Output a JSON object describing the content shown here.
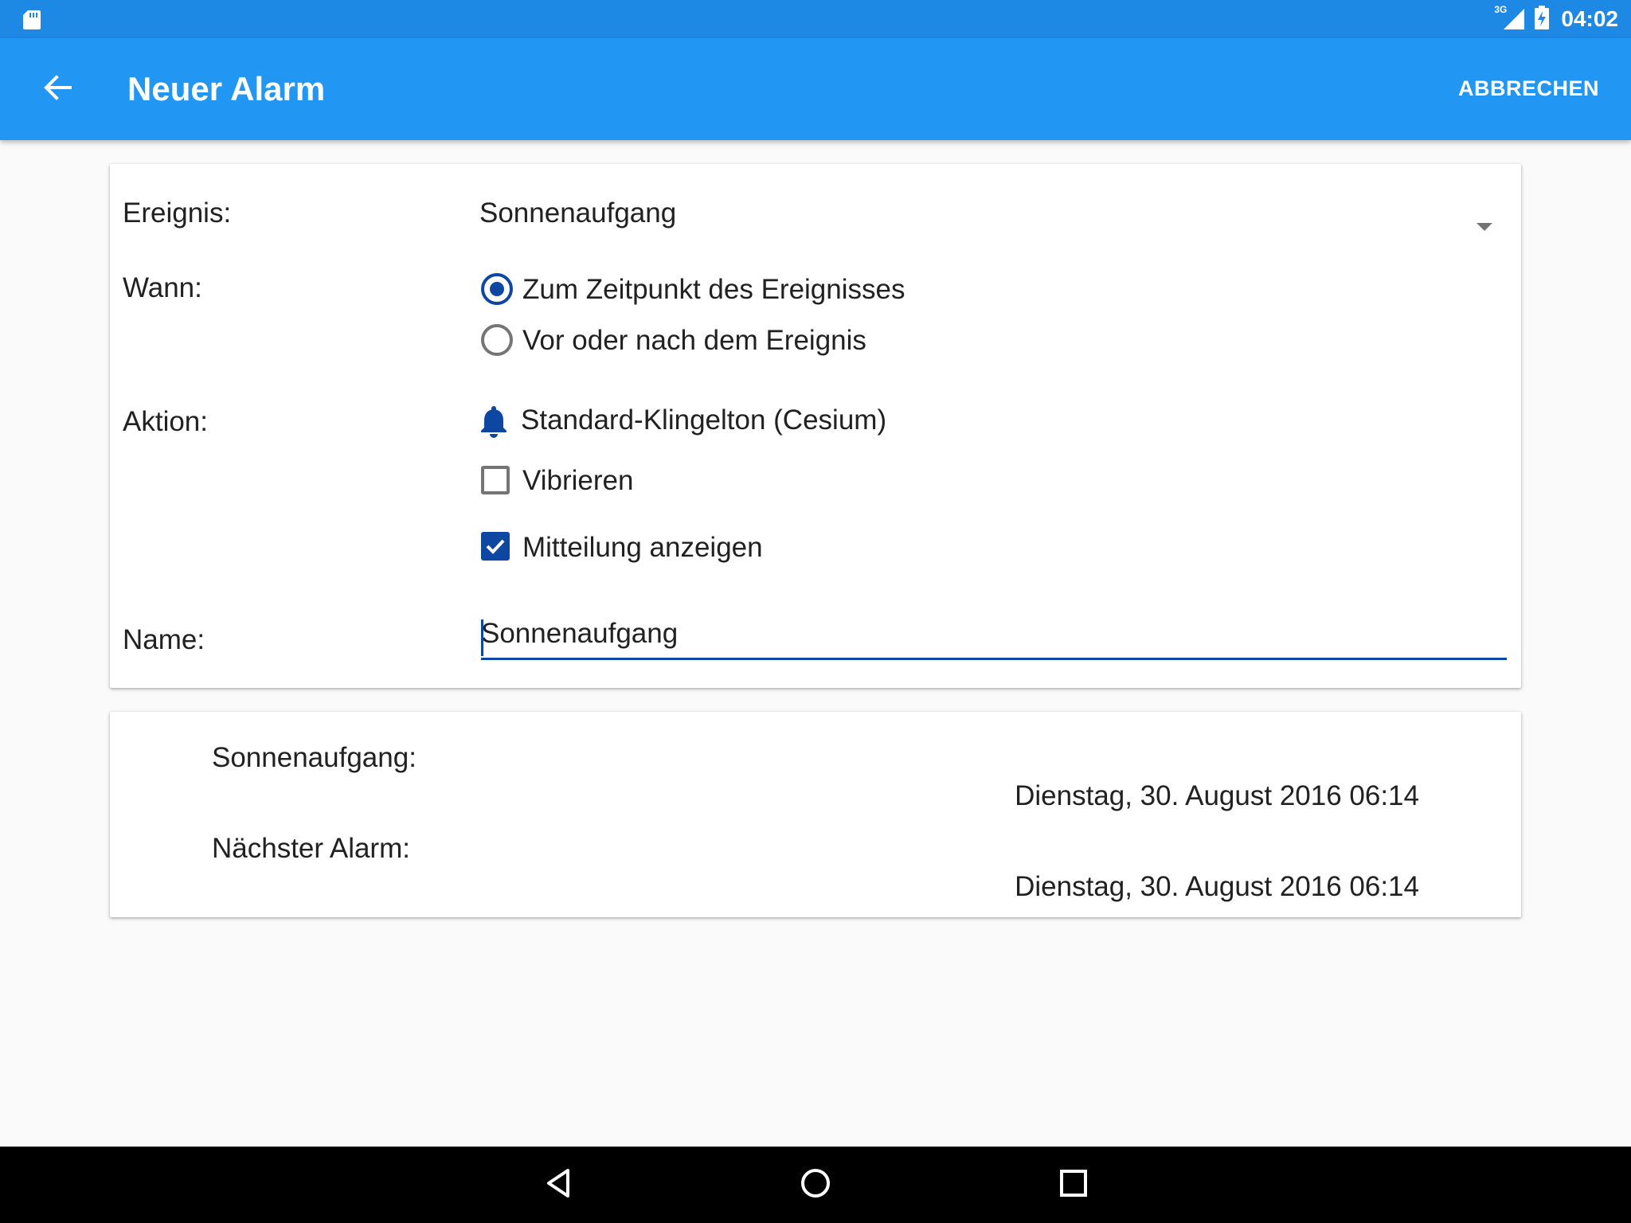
{
  "status_bar": {
    "time": "04:02",
    "network": "3G",
    "icons": [
      "sd-card-icon",
      "signal-icon",
      "battery-charging-icon"
    ]
  },
  "app_bar": {
    "title": "Neuer Alarm",
    "back_icon": "arrow-back-icon",
    "cancel_label": "ABBRECHEN"
  },
  "form": {
    "event_label": "Ereignis:",
    "event_value": "Sonnenaufgang",
    "when_label": "Wann:",
    "when_options": [
      {
        "label": "Zum Zeitpunkt des Ereignisses",
        "selected": true
      },
      {
        "label": "Vor oder nach dem Ereignis",
        "selected": false
      }
    ],
    "action_label": "Aktion:",
    "ringtone": "Standard-Klingelton (Cesium)",
    "ringtone_icon": "bell-icon",
    "vibrate_label": "Vibrieren",
    "vibrate_checked": false,
    "notification_label": "Mitteilung anzeigen",
    "notification_checked": true,
    "name_label": "Name:",
    "name_value": "Sonnenaufgang"
  },
  "info": {
    "sunrise_label": "Sonnenaufgang:",
    "sunrise_value": "Dienstag, 30. August 2016 06:14",
    "next_alarm_label": "Nächster Alarm:",
    "next_alarm_value": "Dienstag, 30. August 2016 06:14"
  },
  "colors": {
    "status_bar": "#1e88e5",
    "app_bar": "#2196f3",
    "accent": "#0d47a1",
    "background": "#fafafa"
  },
  "nav_bar": {
    "icons": [
      "back-triangle-icon",
      "home-circle-icon",
      "recents-square-icon"
    ]
  }
}
